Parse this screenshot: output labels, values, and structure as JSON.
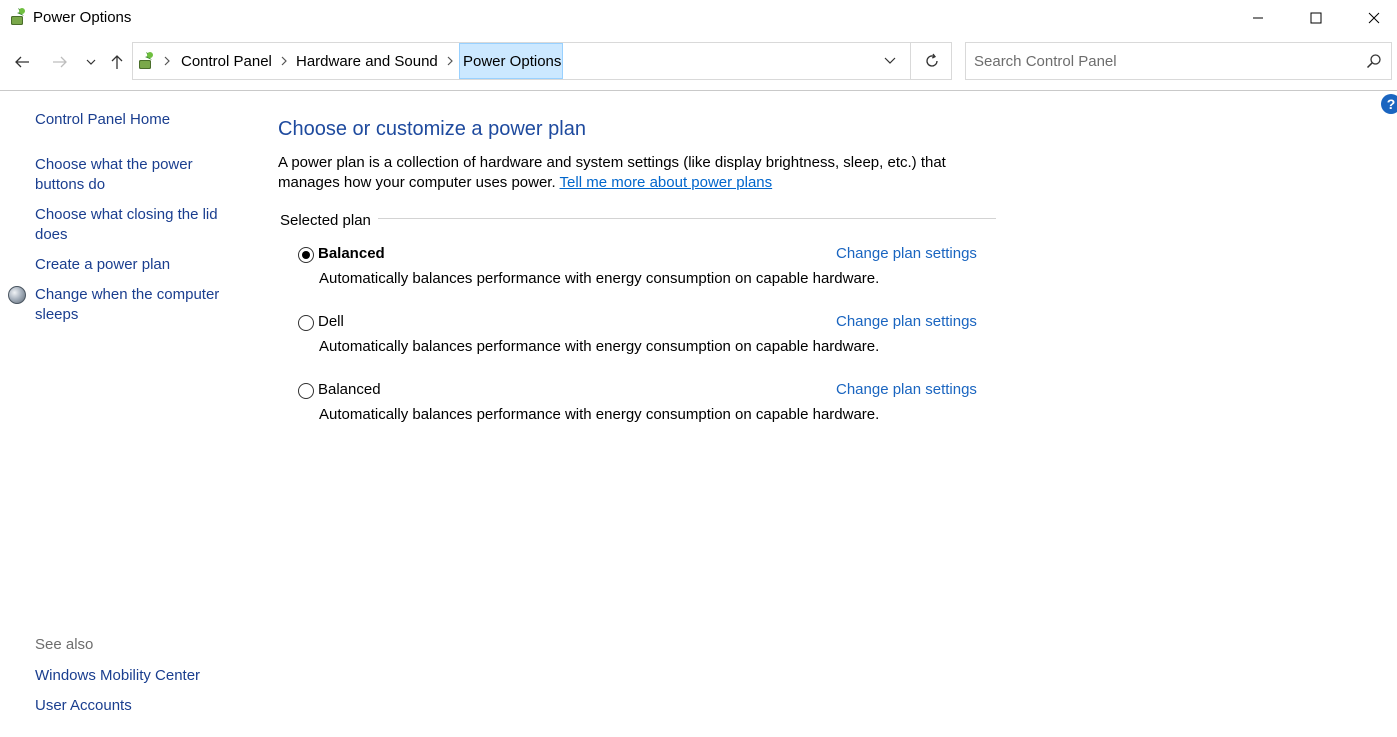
{
  "window": {
    "title": "Power Options",
    "icon": "power-options-icon"
  },
  "address_bar": {
    "breadcrumbs": [
      {
        "label": "Control Panel"
      },
      {
        "label": "Hardware and Sound"
      },
      {
        "label": "Power Options"
      }
    ]
  },
  "search": {
    "placeholder": "Search Control Panel"
  },
  "sidebar": {
    "home": "Control Panel Home",
    "items": [
      {
        "label": "Choose what the power buttons do"
      },
      {
        "label": "Choose what closing the lid does"
      },
      {
        "label": "Create a power plan"
      },
      {
        "label": "Change when the computer sleeps",
        "icon": "moon-sleep-icon"
      }
    ],
    "see_also": {
      "heading": "See also",
      "links": [
        {
          "label": "Windows Mobility Center"
        },
        {
          "label": "User Accounts"
        }
      ]
    }
  },
  "main": {
    "title": "Choose or customize a power plan",
    "intro_text": "A power plan is a collection of hardware and system settings (like display brightness, sleep, etc.) that manages how your computer uses power. ",
    "intro_link": "Tell me more about power plans",
    "selected_plan_label": "Selected plan",
    "plans": [
      {
        "name": "Balanced",
        "selected": true,
        "change_label": "Change plan settings",
        "description": "Automatically balances performance with energy consumption on capable hardware."
      },
      {
        "name": "Dell",
        "selected": false,
        "change_label": "Change plan settings",
        "description": "Automatically balances performance with energy consumption on capable hardware."
      },
      {
        "name": "Balanced",
        "selected": false,
        "change_label": "Change plan settings",
        "description": "Automatically balances performance with energy consumption on capable hardware."
      }
    ]
  },
  "help": {
    "label": "?"
  },
  "colors": {
    "link": "#1a3e8f",
    "accent_link": "#0066cc",
    "title": "#1e4a9e",
    "current_crumb_bg": "#cce8ff"
  }
}
